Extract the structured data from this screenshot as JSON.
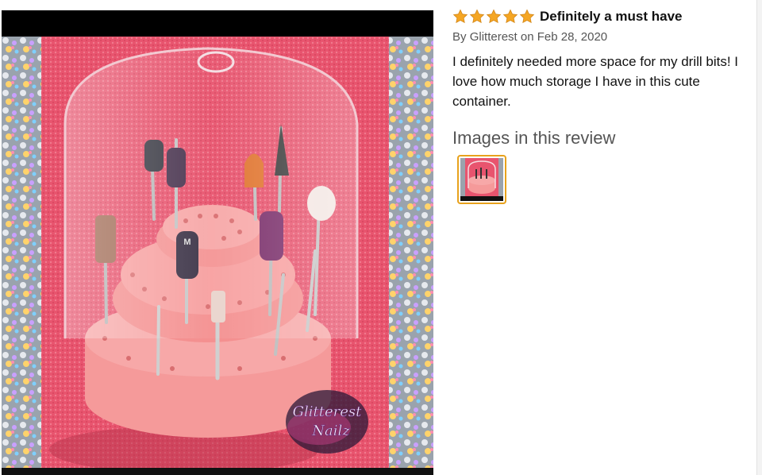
{
  "review": {
    "rating": 5,
    "rating_max": 5,
    "title": "Definitely a must have",
    "byline_prefix": "By",
    "author": "Glitterest",
    "date": "on Feb 28, 2020",
    "body": "I definitely needed more space for my drill bits! I love how much storage I have in this cute container."
  },
  "images_section": {
    "heading": "Images in this review"
  },
  "photo": {
    "watermark_line1": "Glitterest",
    "watermark_line2": "Nailz",
    "bit_label": "M"
  },
  "colors": {
    "star": "#f5a623",
    "thumb_border": "#e8a21d",
    "towel": "#e8546e",
    "holder": "#f28f8f"
  },
  "icons": {
    "star": "star-filled-icon"
  }
}
